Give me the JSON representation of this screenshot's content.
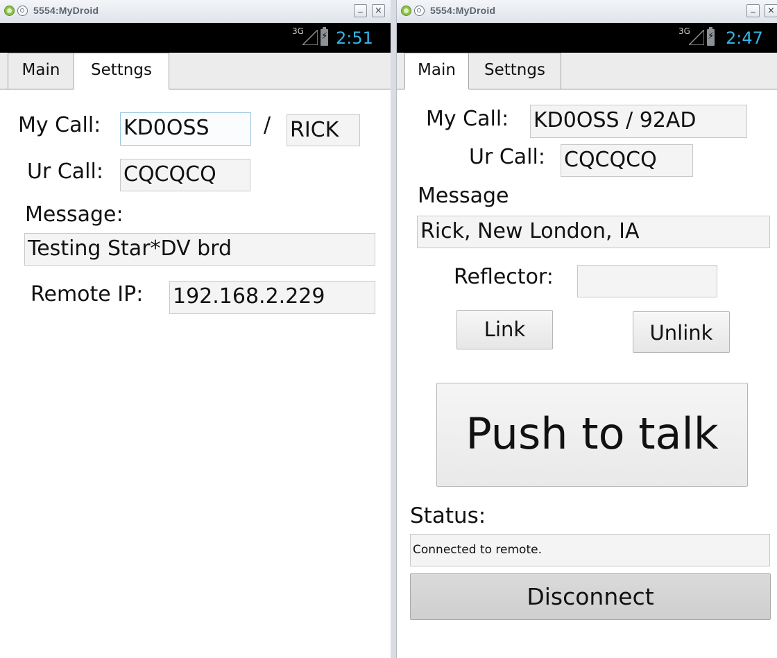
{
  "left": {
    "window_title": "5554:MyDroid",
    "status_bar": {
      "network": "3G",
      "time": "2:51"
    },
    "tabs": [
      {
        "label": "Main"
      },
      {
        "label": "Settngs"
      }
    ],
    "settings": {
      "my_call_label": "My Call:",
      "my_call_value": "KD0OSS",
      "separator": "/",
      "suffix_value": "RICK",
      "ur_call_label": "Ur Call:",
      "ur_call_value": "CQCQCQ",
      "message_label": "Message:",
      "message_value": "Testing Star*DV brd",
      "remote_ip_label": "Remote IP:",
      "remote_ip_value": "192.168.2.229"
    }
  },
  "right": {
    "window_title": "5554:MyDroid",
    "status_bar": {
      "network": "3G",
      "time": "2:47"
    },
    "tabs": [
      {
        "label": "Main"
      },
      {
        "label": "Settngs"
      }
    ],
    "main": {
      "my_call_label": "My Call:",
      "my_call_value": "KD0OSS   / 92AD",
      "ur_call_label": "Ur Call:",
      "ur_call_value": "CQCQCQ",
      "message_label": "Message",
      "message_value": "Rick, New London, IA",
      "reflector_label": "Reflector:",
      "reflector_value": "",
      "link_label": "Link",
      "unlink_label": "Unlink",
      "ptt_label": "Push to talk",
      "status_label": "Status:",
      "status_value": "Connected to remote.",
      "disconnect_label": "Disconnect"
    }
  },
  "window_controls": {
    "minimize": "_",
    "close": "×"
  },
  "colors": {
    "clock": "#33b5e5",
    "status_bar_bg": "#000000",
    "tab_bar_bg": "#ececec"
  }
}
